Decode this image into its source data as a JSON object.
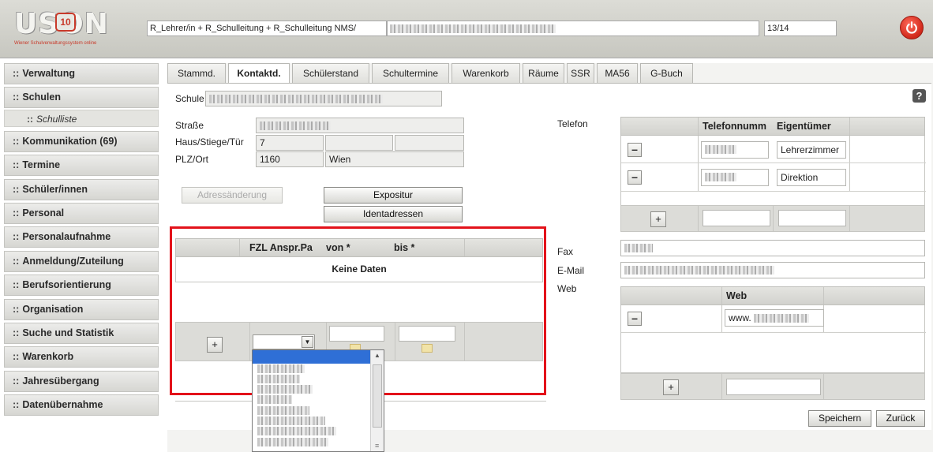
{
  "header": {
    "logo_word": "USON",
    "logo_number": "10",
    "logo_tagline": "Wiener Schulverwaltungssystem online",
    "role_field": "R_Lehrer/in + R_Schulleitung + R_Schulleitung NMS/",
    "year_field": "13/14",
    "power_icon": "power-icon"
  },
  "sidebar": {
    "items": [
      {
        "label": "Verwaltung"
      },
      {
        "label": "Schulen"
      },
      {
        "label": "Schulliste"
      },
      {
        "label": "Kommunikation (69)"
      },
      {
        "label": "Termine"
      },
      {
        "label": "Schüler/innen"
      },
      {
        "label": "Personal"
      },
      {
        "label": "Personalaufnahme"
      },
      {
        "label": "Anmeldung/Zuteilung"
      },
      {
        "label": "Berufsorientierung"
      },
      {
        "label": "Organisation"
      },
      {
        "label": "Suche und Statistik"
      },
      {
        "label": "Warenkorb"
      },
      {
        "label": "Jahresübergang"
      },
      {
        "label": "Datenübernahme"
      }
    ]
  },
  "tabs": [
    {
      "label": "Stammd."
    },
    {
      "label": "Kontaktd."
    },
    {
      "label": "Schülerstand"
    },
    {
      "label": "Schultermine"
    },
    {
      "label": "Warenkorb"
    },
    {
      "label": "Räume"
    },
    {
      "label": "SSR"
    },
    {
      "label": "MA56"
    },
    {
      "label": "G-Buch"
    }
  ],
  "form": {
    "schule_label": "Schule",
    "strasse_label": "Straße",
    "haus_label": "Haus/Stiege/Tür",
    "haus_value": "7",
    "plz_label": "PLZ/Ort",
    "plz_value": "1160",
    "ort_value": "Wien",
    "telefon_label": "Telefon",
    "fax_label": "Fax",
    "email_label": "E-Mail",
    "web_label": "Web",
    "adressaenderung_btn": "Adressänderung",
    "expositur_btn": "Expositur",
    "identadressen_btn": "Identadressen"
  },
  "phone_table": {
    "headers": [
      "Telefonnumm",
      "Eigentümer"
    ],
    "rows": [
      {
        "owner": "Lehrerzimmer"
      },
      {
        "owner": "Direktion"
      }
    ]
  },
  "web_table": {
    "header": "Web",
    "value": "www."
  },
  "contact_table": {
    "headers": [
      "FZL Anspr.Pa",
      "von *",
      "bis *"
    ],
    "empty_text": "Keine Daten"
  },
  "footer": {
    "save_btn": "Speichern",
    "back_btn": "Zurück"
  },
  "colors": {
    "highlight_border": "#e3121a",
    "power_button": "#d0281a",
    "selected_option": "#2f6fd6"
  }
}
